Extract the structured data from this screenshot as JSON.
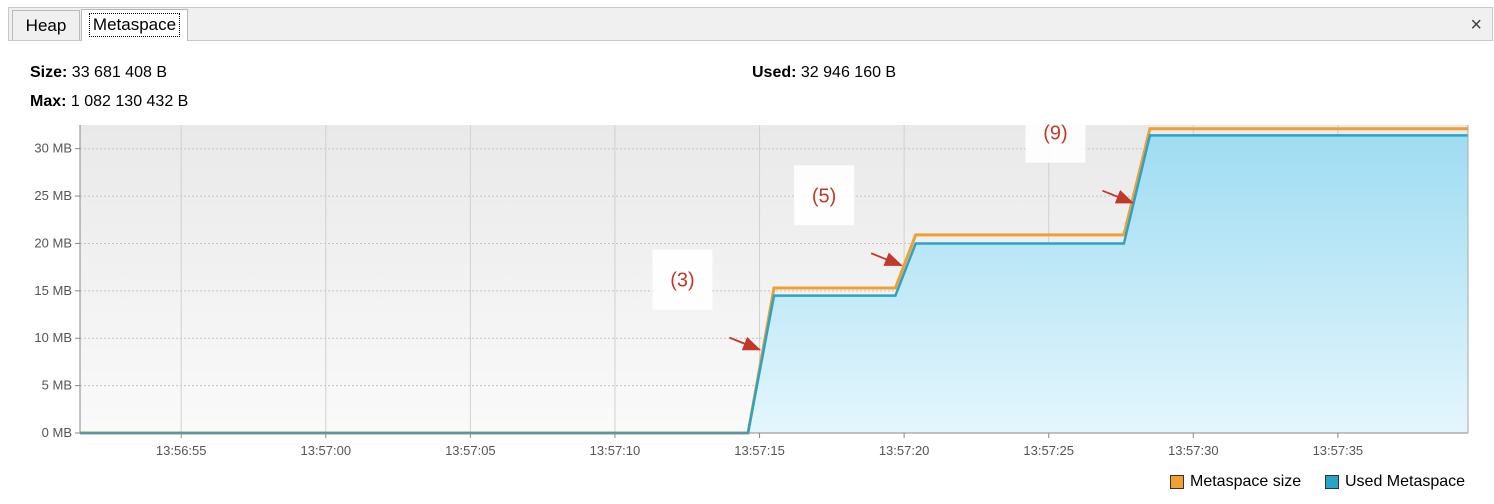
{
  "tabs": [
    {
      "label": "Heap"
    },
    {
      "label": "Metaspace"
    }
  ],
  "close_symbol": "×",
  "info": {
    "size_label": "Size:",
    "size_value": "33 681 408 B",
    "max_label": "Max:",
    "max_value": "1 082 130 432 B",
    "used_label": "Used:",
    "used_value": "32 946 160 B"
  },
  "colors": {
    "size_line": "#f0a030",
    "used_line": "#2aa3c8",
    "fill_top": "#9fdcf2",
    "fill_bottom": "#e4f6fd",
    "annotation": "#c0392b"
  },
  "chart_data": {
    "type": "area",
    "y_ticks": [
      "0 MB",
      "5 MB",
      "10 MB",
      "15 MB",
      "20 MB",
      "25 MB",
      "30 MB"
    ],
    "x_ticks": [
      "13:56:55",
      "13:57:00",
      "13:57:05",
      "13:57:10",
      "13:57:15",
      "13:57:20",
      "13:57:25",
      "13:57:30",
      "13:57:35"
    ],
    "x_range": [
      "13:56:51.5",
      "13:57:39.5"
    ],
    "ylim": [
      0,
      32.5
    ],
    "grid": true,
    "legend_position": "bottom-right",
    "series": [
      {
        "name": "Metaspace size",
        "color": "#f0a030",
        "points": [
          [
            "13:56:51.5",
            0
          ],
          [
            "13:57:14.6",
            0
          ],
          [
            "13:57:15.5",
            15.3
          ],
          [
            "13:57:19.7",
            15.3
          ],
          [
            "13:57:20.4",
            20.9
          ],
          [
            "13:57:27.6",
            20.9
          ],
          [
            "13:57:28.5",
            32.1
          ],
          [
            "13:57:39.5",
            32.1
          ]
        ]
      },
      {
        "name": "Used Metaspace",
        "color": "#2aa3c8",
        "points": [
          [
            "13:56:51.5",
            0
          ],
          [
            "13:57:14.6",
            0
          ],
          [
            "13:57:15.5",
            14.5
          ],
          [
            "13:57:19.7",
            14.5
          ],
          [
            "13:57:20.4",
            20.0
          ],
          [
            "13:57:27.6",
            20.0
          ],
          [
            "13:57:28.5",
            31.4
          ],
          [
            "13:57:39.5",
            31.4
          ]
        ]
      }
    ],
    "annotations": [
      {
        "text": "(3)",
        "x": "13:57:15.1",
        "y": 8.8
      },
      {
        "text": "(5)",
        "x": "13:57:20",
        "y": 17.7
      },
      {
        "text": "(9)",
        "x": "13:57:28",
        "y": 24.3
      }
    ]
  },
  "legend": [
    {
      "label": "Metaspace size",
      "color": "#f0a030"
    },
    {
      "label": "Used Metaspace",
      "color": "#2aa3c8"
    }
  ]
}
